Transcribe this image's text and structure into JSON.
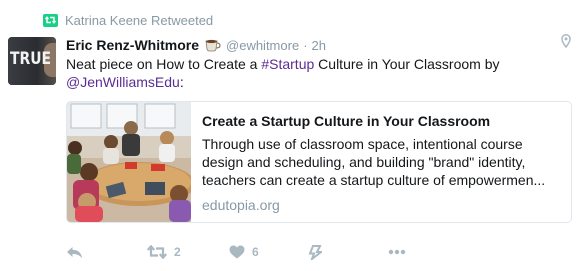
{
  "retweet_context": {
    "text": "Katrina Keene Retweeted",
    "icon": "retweet-icon",
    "color": "#19cf86"
  },
  "author": {
    "fullname": "Eric Renz-Whitmore",
    "emoji": "coffee-emoji",
    "handle": "@ewhitmore",
    "separator": "·",
    "time": "2h",
    "avatar_text": "TRUE"
  },
  "tweet": {
    "text_before": "Neat piece on How to Create a ",
    "hashtag": "#Startup",
    "text_middle": " Culture in Your Classroom by ",
    "mention": "@JenWilliamsEdu",
    "text_after": ":",
    "link_color": "#5c2d91"
  },
  "card": {
    "title": "Create a Startup Culture in Your Classroom",
    "description": "Through use of classroom space, intentional course design and scheduling, and building \"brand\" identity, teachers can create a startup culture of empowermen...",
    "domain": "edutopia.org"
  },
  "actions": {
    "reply": {
      "icon": "reply-icon"
    },
    "retweet": {
      "icon": "retweet-icon",
      "count": "2"
    },
    "like": {
      "icon": "heart-icon",
      "count": "6"
    },
    "moments": {
      "icon": "moments-icon"
    },
    "more": {
      "icon": "more-icon"
    },
    "icon_color": "#aab8c2"
  }
}
